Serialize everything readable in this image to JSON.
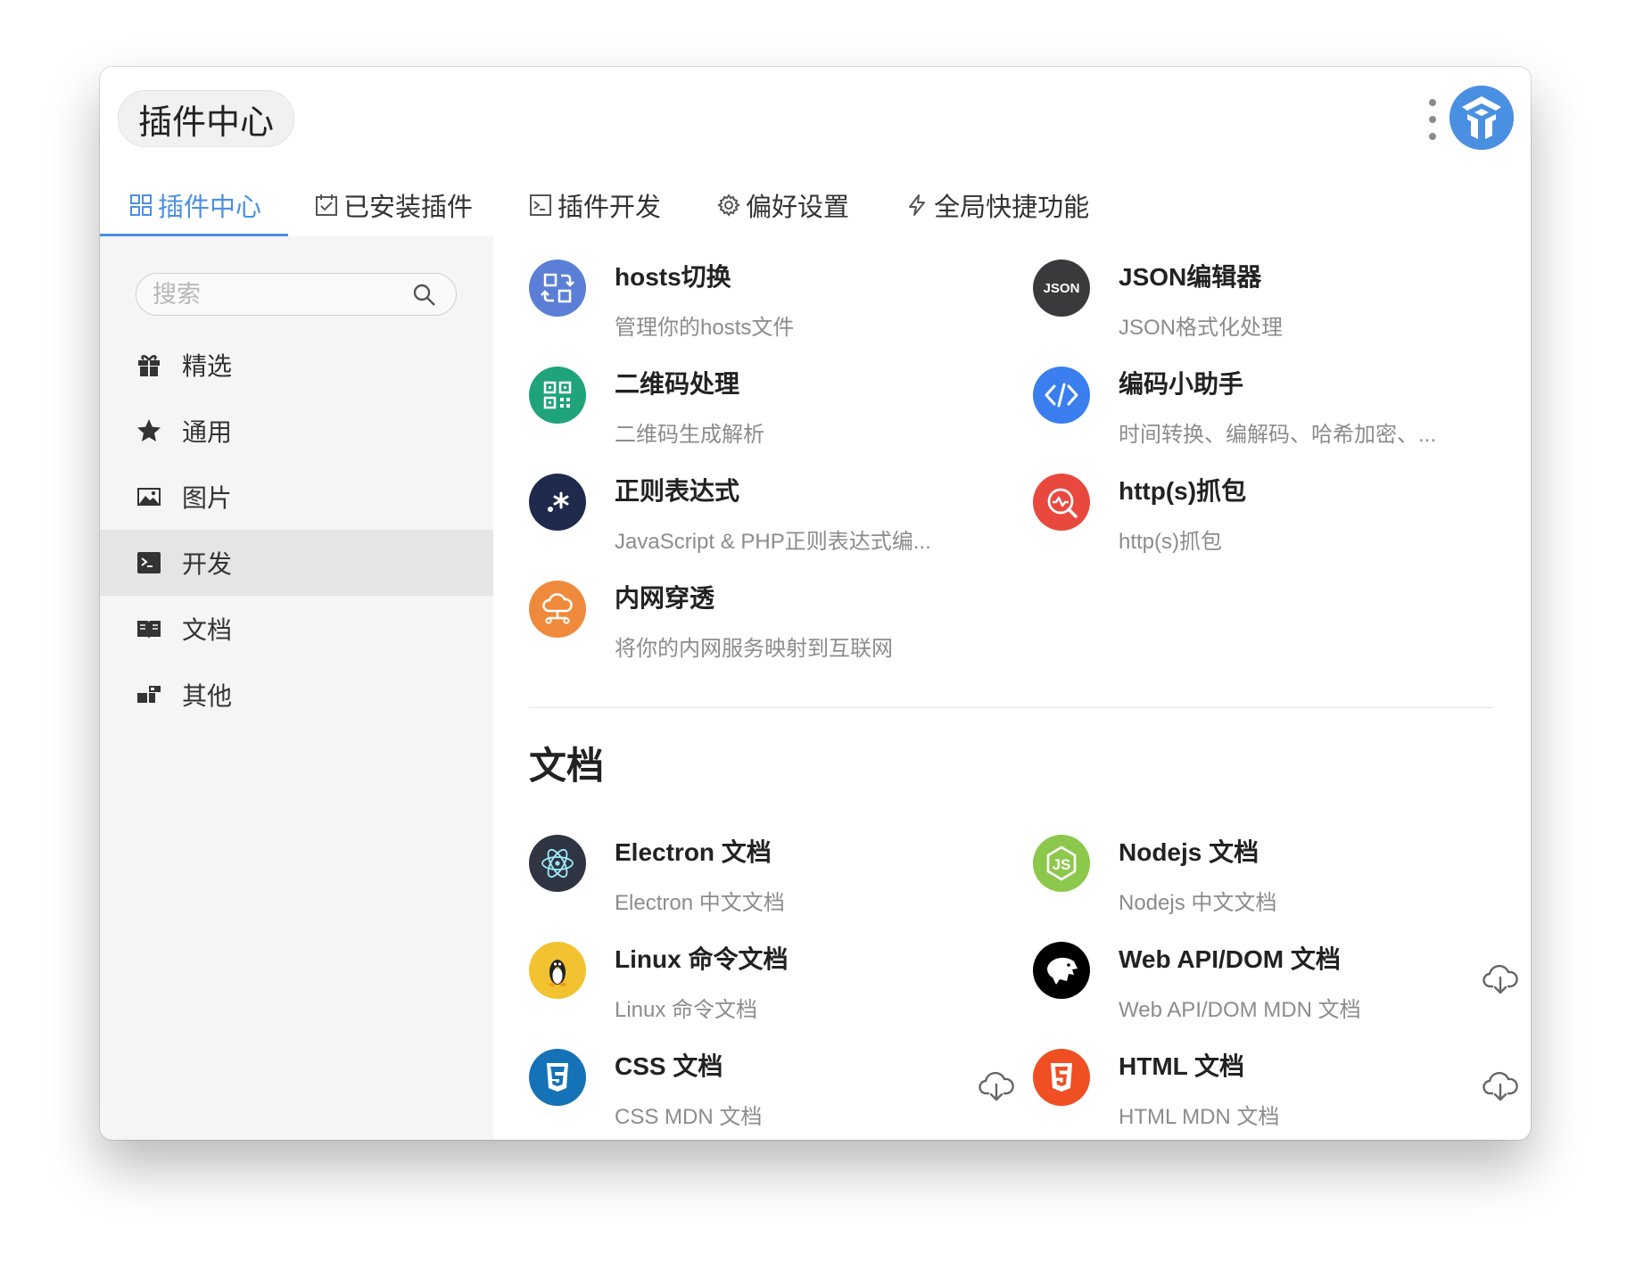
{
  "app": {
    "title": "插件中心"
  },
  "tabs": [
    {
      "label": "插件中心",
      "icon": "grid-icon"
    },
    {
      "label": "已安装插件",
      "icon": "calendar-check-icon"
    },
    {
      "label": "插件开发",
      "icon": "terminal-box-icon"
    },
    {
      "label": "偏好设置",
      "icon": "gear-icon"
    },
    {
      "label": "全局快捷功能",
      "icon": "lightning-icon"
    }
  ],
  "search": {
    "placeholder": "搜索"
  },
  "sidebar": {
    "items": [
      {
        "label": "精选",
        "icon": "gift-icon"
      },
      {
        "label": "通用",
        "icon": "star-icon"
      },
      {
        "label": "图片",
        "icon": "image-icon"
      },
      {
        "label": "开发",
        "icon": "terminal-icon",
        "active": true
      },
      {
        "label": "文档",
        "icon": "book-icon"
      },
      {
        "label": "其他",
        "icon": "blocks-icon"
      }
    ]
  },
  "dev_plugins": [
    {
      "title": "hosts切换",
      "desc": "管理你的hosts文件",
      "color": "#5b7fd6",
      "icon": "switch-icon"
    },
    {
      "title": "JSON编辑器",
      "desc": "JSON格式化处理",
      "color": "#3a3a3c",
      "icon": "json-icon"
    },
    {
      "title": "二维码处理",
      "desc": "二维码生成解析",
      "color": "#1fa37a",
      "icon": "qrcode-icon"
    },
    {
      "title": "编码小助手",
      "desc": "时间转换、编解码、哈希加密、...",
      "color": "#3a7ef0",
      "icon": "code-icon"
    },
    {
      "title": "正则表达式",
      "desc": "JavaScript & PHP正则表达式编...",
      "color": "#1e2b4d",
      "icon": "regex-icon"
    },
    {
      "title": "http(s)抓包",
      "desc": "http(s)抓包",
      "color": "#e9483f",
      "icon": "capture-icon"
    },
    {
      "title": "内网穿透",
      "desc": "将你的内网服务映射到互联网",
      "color": "#ef8a3c",
      "icon": "cloud-network-icon"
    }
  ],
  "docs": {
    "title": "文档",
    "items": [
      {
        "title": "Electron 文档",
        "desc": "Electron 中文文档",
        "color": "#2f3542",
        "icon": "electron-icon",
        "download": false
      },
      {
        "title": "Nodejs 文档",
        "desc": "Nodejs 中文文档",
        "color": "#8cc84b",
        "icon": "nodejs-icon",
        "download": false
      },
      {
        "title": "Linux 命令文档",
        "desc": "Linux 命令文档",
        "color": "#f2c230",
        "icon": "penguin-icon",
        "download": false
      },
      {
        "title": "Web API/DOM 文档",
        "desc": "Web API/DOM MDN 文档",
        "color": "#000000",
        "icon": "mdn-dino-icon",
        "download": true
      },
      {
        "title": "CSS 文档",
        "desc": "CSS MDN 文档",
        "color": "#1572b6",
        "icon": "css3-icon",
        "download": true
      },
      {
        "title": "HTML 文档",
        "desc": "HTML MDN 文档",
        "color": "#f04e23",
        "icon": "html5-icon",
        "download": true
      }
    ]
  }
}
